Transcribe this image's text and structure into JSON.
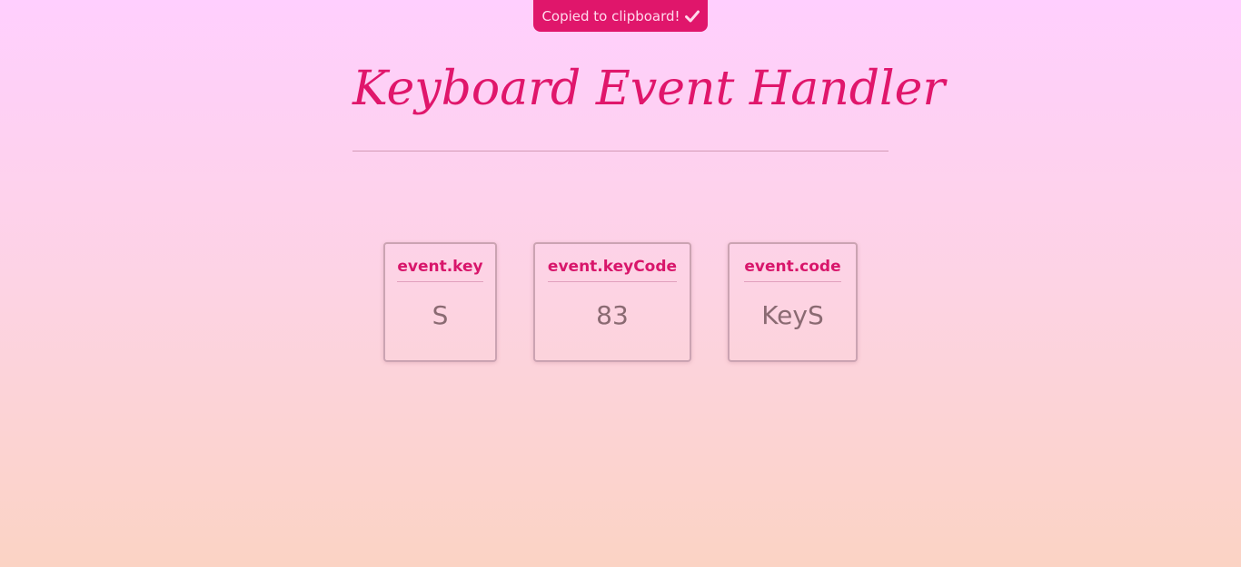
{
  "toast": {
    "message": "Copied to clipboard!",
    "icon": "check-icon",
    "background": "#e0166b"
  },
  "header": {
    "title": "Keyboard Event Handler"
  },
  "cards": [
    {
      "label": "event.key",
      "value": "S"
    },
    {
      "label": "event.keyCode",
      "value": "83"
    },
    {
      "label": "event.code",
      "value": "KeyS"
    }
  ],
  "colors": {
    "accent": "#e0166b",
    "value_text": "#8a6a72"
  }
}
